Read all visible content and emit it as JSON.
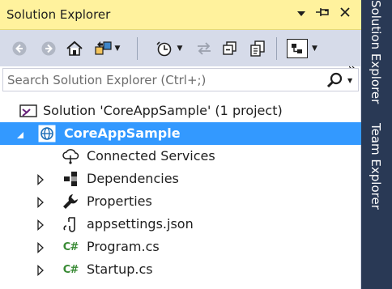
{
  "panel": {
    "title": "Solution Explorer",
    "controls": [
      "dropdown-arrow-icon",
      "pin-icon",
      "close-icon"
    ]
  },
  "toolbar": {
    "tools": [
      "back-icon",
      "forward-icon",
      "home-icon",
      "switch-views-icon",
      "pending-changes-filter-icon",
      "sync-icon",
      "collapse-all-icon",
      "copy-icon",
      "show-all-files-icon",
      "overflow-icon"
    ]
  },
  "search": {
    "placeholder": "Search Solution Explorer (Ctrl+;)",
    "value": ""
  },
  "tree": {
    "solution": "Solution 'CoreAppSample' (1 project)",
    "project": "CoreAppSample",
    "items": [
      {
        "label": "Connected Services",
        "icon": "connected-services-icon"
      },
      {
        "label": "Dependencies",
        "icon": "dependencies-icon"
      },
      {
        "label": "Properties",
        "icon": "wrench-icon"
      },
      {
        "label": "appsettings.json",
        "icon": "json-file-icon"
      },
      {
        "label": "Program.cs",
        "icon": "csharp-file-icon"
      },
      {
        "label": "Startup.cs",
        "icon": "csharp-file-icon"
      }
    ],
    "csharp_glyph": "C#"
  },
  "side_tabs": [
    "Solution Explorer",
    "Team Explorer"
  ],
  "colors": {
    "title_bar": "#fff29d",
    "toolbar": "#d6dbe9",
    "selection": "#3399ff",
    "side_strip": "#293955",
    "csharp_green": "#388a34"
  }
}
